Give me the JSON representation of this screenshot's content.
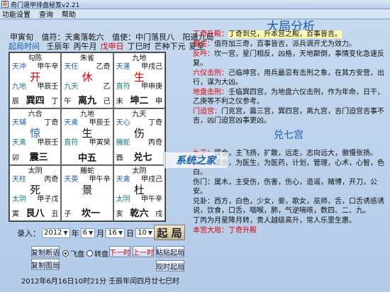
{
  "window": {
    "title": "奇门遁甲排盘秘笈v2.21",
    "icon": "app-icon"
  },
  "menu": [
    "功能设置",
    "查询",
    "帮助"
  ],
  "header": {
    "info": [
      "甲寅旬",
      "值符：天禽落乾六",
      "值使：中门落艮八",
      "阳遁九局"
    ],
    "qiju_label": "起局时间",
    "ganzhi": [
      {
        "text": "壬辰年",
        "color": "plain"
      },
      {
        "text": "丙午月",
        "color": "plain"
      },
      {
        "text": "戊申日",
        "color": "red"
      },
      {
        "text": "丁巳时",
        "color": "plain"
      },
      {
        "text": "芒种下元",
        "color": "plain"
      },
      {
        "text": "夏至",
        "color": "plain"
      }
    ]
  },
  "palaces": [
    {
      "god": "勾陈",
      "star_row": [
        "天冲",
        "甲午辛"
      ],
      "door": "开",
      "door_color": "red",
      "side_row": [
        "九地",
        "甲辰壬"
      ],
      "branch": "辰",
      "name": "巽四",
      "side": "丁"
    },
    {
      "god": "朱雀",
      "star_row": [
        "天任",
        "乙奇"
      ],
      "door": "休",
      "door_color": "red",
      "side_row": [
        "九天",
        "乙"
      ],
      "branch": "午",
      "name": "离九",
      "side": "己"
    },
    {
      "god": "九地",
      "star_row": [
        "天蓬",
        "甲戌己"
      ],
      "door": "生",
      "door_color": "red",
      "side_row": [
        "直符",
        "甲申庚"
      ],
      "branch": "未",
      "name": "坤二",
      "side": "申"
    },
    {
      "god": "六合",
      "star_row": [
        "天辅",
        "丁奇"
      ],
      "door": "惊",
      "door_color": "blue",
      "side_row": [
        "天禽",
        "甲辰壬"
      ],
      "branch": "卯",
      "name": "震三",
      "side": ""
    },
    {
      "god": "九地",
      "star_row": [
        "天禽",
        "甲辰壬"
      ],
      "door": "生",
      "door_color": "plain",
      "side_row": [
        "直符",
        "甲寅癸"
      ],
      "branch": "",
      "name": "中五",
      "side": ""
    },
    {
      "god": "九天",
      "star_row": [
        "天心",
        "丁奇"
      ],
      "door": "伤",
      "door_color": "plain",
      "side_row": [
        "螣蛇",
        "丙奇"
      ],
      "branch": "酉",
      "name": "兑七",
      "side": ""
    },
    {
      "god": "太阴",
      "star_row": [
        "天柱",
        "丙奇"
      ],
      "door": "死",
      "door_color": "plain",
      "side_row": [
        "太阴",
        "甲子戊"
      ],
      "branch": "寅",
      "name": "艮八",
      "side": "丑"
    },
    {
      "god": "螣蛇",
      "star_row": [
        "天英",
        "甲午辛"
      ],
      "door": "景",
      "door_color": "plain",
      "side_row": [
        "",
        ""
      ],
      "branch": "子",
      "name": "坎一",
      "side": ""
    },
    {
      "god": "太阴",
      "star_row": [
        "天禽",
        "甲戌己"
      ],
      "door": "杜",
      "door_color": "plain",
      "side_row": [
        "太阴",
        "甲午辛"
      ],
      "branch": "亥",
      "name": "乾六",
      "side": "戌"
    }
  ],
  "controls": {
    "input_label": "录入：",
    "year": "2012",
    "year_unit": "年",
    "month": "6",
    "month_unit": "月",
    "day": "16",
    "day_unit": "日",
    "hour": "10",
    "hour_unit": "时",
    "qiju_button": "起 局",
    "copy_analysis": "复制断语",
    "fly_plate": "飞盘",
    "rotate_plate": "转盘",
    "next_hour": "下一时",
    "prev_hour": "上一时",
    "paste_qiju": "粘贴起局",
    "copy_chart": "复制图局",
    "now_qiju": "现时起局"
  },
  "footer": "2012年6月16日10时21分  壬辰年闰四月廿七巳时",
  "analysis": {
    "title": "大局分析",
    "paragraphs": [
      {
        "key": "丁奇升殿：",
        "text": "丁奇到兑，升本宫之殿，百事皆吉。"
      },
      {
        "key": "相佐：",
        "text": "值符加三奇，百事皆吉，派兵调开尤为效力。"
      },
      {
        "key": "反吟：",
        "text": "坎一宫，星门相反，凶格，天地颠倒，事情变化急速反复。"
      },
      {
        "key": "六仪击刑：",
        "text": "己临坤宫，用兵最忌有击刑之象，在其方安营，出行，谋为大凶。"
      },
      {
        "key": "地盘击刑：",
        "text": "壬临巽四宫，为地盘六仪击刑，作为年命，日干，乙庚等不利之仪参考。"
      },
      {
        "key": "门迫宫：",
        "text": "门克宫，震三宫，巽四宫，离九宫，吉门迫宫吉事不吉，凶门迫宫凶事更凶。"
      }
    ],
    "palace_title": "兑七宫",
    "palace_text": [
      {
        "key": "九天：",
        "text": "属金，主飞扬，扩散，远走，志向远大，傲慢张扬。"
      },
      {
        "key": "",
        "text": "天心：属金，为医生，为医药，计划，管理，心术，心智，色白。"
      },
      {
        "key": "",
        "text": "伤门：属木，主受伤，伤害，伤心，造谣，赌博，开刀，公安。"
      },
      {
        "key": "",
        "text": "兑卦：西方，白色，少女，妾，歌女，巫师，舌，口舌诱惑诱说，饮食，口舌，咽喉，肺，气逆喘咳，数四、二、九。"
      },
      {
        "key": "",
        "text": "丁丙为月星降月转，贵人越级高升，常人乐里生惠。"
      },
      {
        "key": "本宫大局：",
        "text": "丁奇升殿"
      }
    ],
    "watermark": "系统之家"
  }
}
